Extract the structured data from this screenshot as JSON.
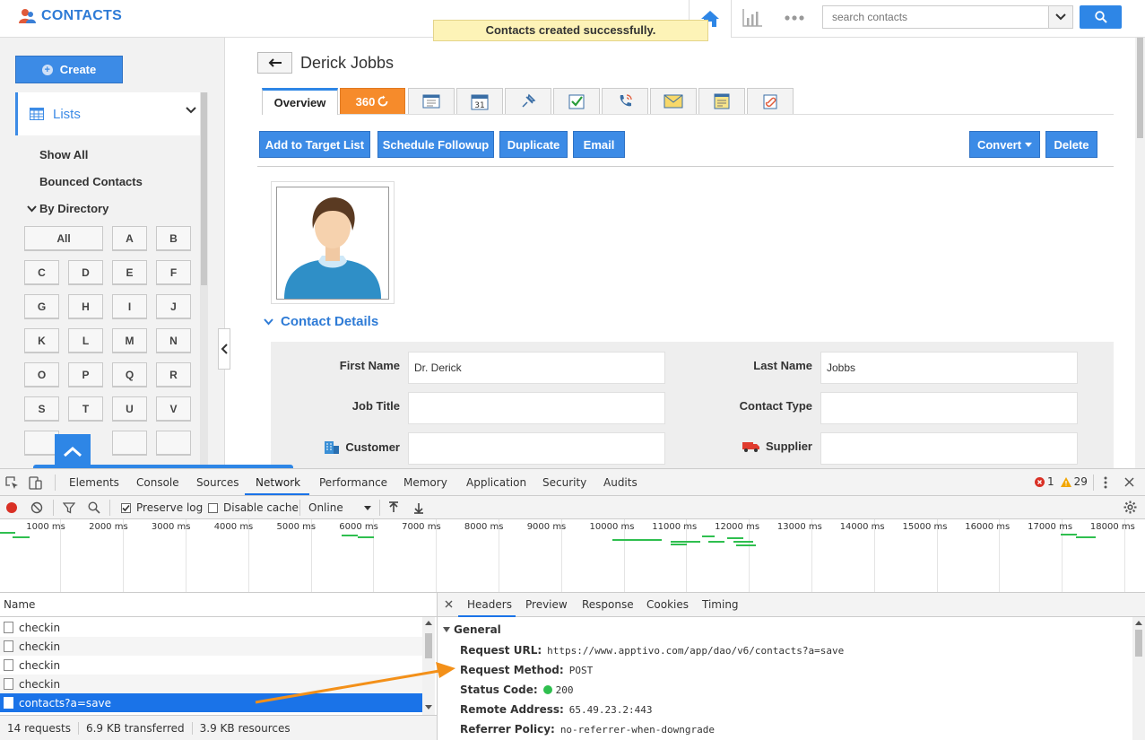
{
  "app": {
    "title": "CONTACTS",
    "toast": "Contacts created successfully.",
    "search": {
      "placeholder": "search contacts"
    }
  },
  "sidebar": {
    "create_label": "Create",
    "lists_label": "Lists",
    "links": [
      "Show All",
      "Bounced Contacts"
    ],
    "by_directory_label": "By Directory",
    "letters": [
      "All",
      "A",
      "B",
      "C",
      "D",
      "E",
      "F",
      "G",
      "H",
      "I",
      "J",
      "K",
      "L",
      "M",
      "N",
      "O",
      "P",
      "Q",
      "R",
      "S",
      "T",
      "U",
      "V"
    ]
  },
  "contact": {
    "name": "Derick Jobbs",
    "tabs": {
      "overview": "Overview",
      "t360": "360"
    },
    "actions": {
      "add_to_target": "Add to Target List",
      "schedule_followup": "Schedule Followup",
      "duplicate": "Duplicate",
      "email": "Email",
      "convert": "Convert",
      "delete": "Delete"
    },
    "section_title": "Contact Details",
    "fields": {
      "first_name_label": "First Name",
      "first_name_value": "Dr. Derick",
      "last_name_label": "Last Name",
      "last_name_value": "Jobbs",
      "job_title_label": "Job Title",
      "job_title_value": "",
      "contact_type_label": "Contact Type",
      "contact_type_value": "",
      "customer_label": "Customer",
      "customer_value": "",
      "supplier_label": "Supplier",
      "supplier_value": ""
    }
  },
  "devtools": {
    "tabs": [
      "Elements",
      "Console",
      "Sources",
      "Network",
      "Performance",
      "Memory",
      "Application",
      "Security",
      "Audits"
    ],
    "active_tab": "Network",
    "error_count": "1",
    "warning_count": "29",
    "toolbar": {
      "preserve_log": "Preserve log",
      "disable_cache": "Disable cache",
      "throttle": "Online"
    },
    "timeline_ticks": [
      "1000 ms",
      "2000 ms",
      "3000 ms",
      "4000 ms",
      "5000 ms",
      "6000 ms",
      "7000 ms",
      "8000 ms",
      "9000 ms",
      "10000 ms",
      "11000 ms",
      "12000 ms",
      "13000 ms",
      "14000 ms",
      "15000 ms",
      "16000 ms",
      "17000 ms",
      "18000 ms"
    ],
    "name_header": "Name",
    "requests": [
      "checkin",
      "checkin",
      "checkin",
      "checkin",
      "contacts?a=save"
    ],
    "selected_request": "contacts?a=save",
    "status": {
      "requests": "14 requests",
      "transferred": "6.9 KB transferred",
      "resources": "3.9 KB resources"
    },
    "detail_tabs": [
      "Headers",
      "Preview",
      "Response",
      "Cookies",
      "Timing"
    ],
    "general_label": "General",
    "general": {
      "url_label": "Request URL:",
      "url": "https://www.apptivo.com/app/dao/v6/contacts?a=save",
      "method_label": "Request Method:",
      "method": "POST",
      "status_label": "Status Code:",
      "status": "200",
      "remote_label": "Remote Address:",
      "remote": "65.49.23.2:443",
      "referrer_label": "Referrer Policy:",
      "referrer": "no-referrer-when-downgrade"
    }
  },
  "colors": {
    "accent": "#2e86e6",
    "tab_360": "#f68b2b",
    "toast_bg": "#fdf3b7",
    "selected_row": "#1a73e8",
    "timeline_bar": "#2fbf4f",
    "annotation_arrow": "#f39019"
  }
}
